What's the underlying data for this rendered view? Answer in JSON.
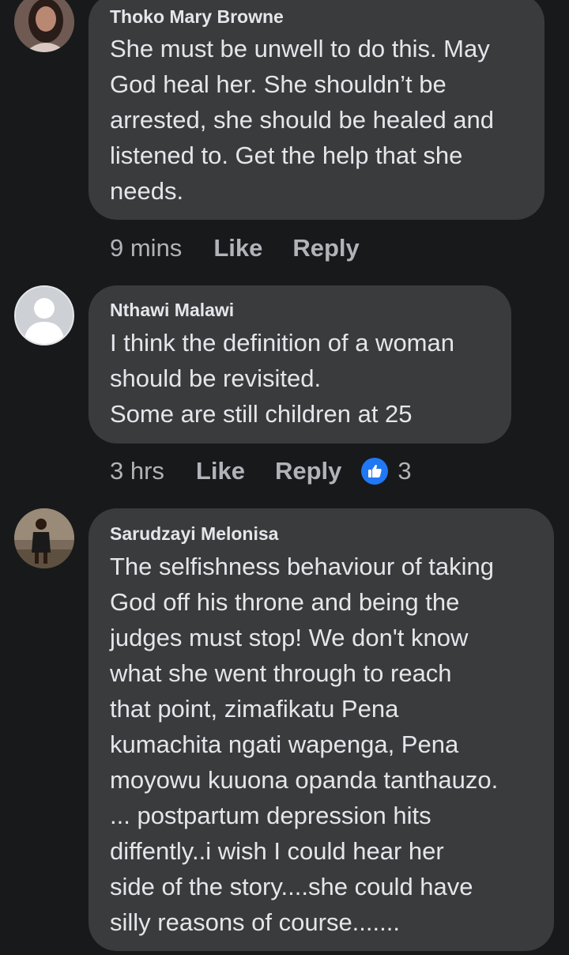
{
  "comments": [
    {
      "author": "Thoko Mary Browne",
      "text": "She must be unwell to do this. May\nGod heal her. She shouldn’t be\narrested, she should be healed and\nlistened to. Get the help that she\nneeds.",
      "time": "9 mins",
      "like_label": "Like",
      "reply_label": "Reply"
    },
    {
      "author": "Nthawi Malawi",
      "text": "I think the definition of a woman\nshould be revisited.\nSome are still children at 25",
      "time": "3 hrs",
      "like_label": "Like",
      "reply_label": "Reply",
      "reaction_count": "3"
    },
    {
      "author": "Sarudzayi  Melonisa",
      "text": "The selfishness behaviour of taking\nGod off his throne and being the\njudges must stop! We don't know\nwhat she went through to reach\nthat point, zimafikatu Pena\nkumachita ngati wapenga, Pena\nmoyowu kuuona opanda tanthauzo.\n... postpartum depression hits\ndiffently..i wish I could hear her\nside of the story....she could have\nsilly reasons of course......."
    }
  ],
  "colors": {
    "background": "#18191a",
    "bubble": "#3a3b3c",
    "text_primary": "#e4e6eb",
    "text_secondary": "#b0b3b8",
    "like_blue": "#2078f4"
  }
}
